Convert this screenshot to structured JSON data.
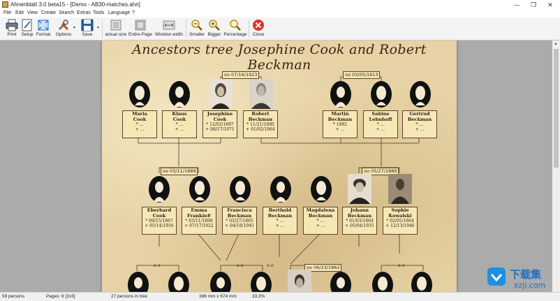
{
  "window": {
    "title": "Ahnenblatt 3.0 beta15 - [Demo - AB30-matches.ahn]",
    "min_glyph": "—",
    "max_glyph": "❐",
    "close_glyph": "✕"
  },
  "menu": [
    "File",
    "Edit",
    "View",
    "Create",
    "Search",
    "Extras",
    "Tools",
    "Language",
    "?"
  ],
  "toolbar": {
    "print": "Print",
    "setup": "Setup",
    "format": "Format",
    "options": "Options",
    "save": "Save",
    "actual_size": "actual size",
    "entire_page": "Entire Page",
    "window_width": "Window width",
    "smaller": "Smaller",
    "bigger": "Bigger",
    "percentage": "Percentage",
    "close": "Close"
  },
  "document": {
    "title": "Ancestors tree Josephine Cook and Robert Beckman",
    "marriages": {
      "top_left": "oo 07/16/1923",
      "top_right": "oo 03/05/1913",
      "mid_left": "oo 03/11/1889",
      "mid_right": "oo 05/27/1889",
      "bottom_center": "oo 06/23/1862",
      "bottom_a": "o-o",
      "bottom_b": "o-o",
      "bottom_c": "o-o",
      "bottom_d": "o-o"
    },
    "row1": [
      {
        "first": "Maria",
        "last": "Cook",
        "b": "* ...",
        "d": "+ ..."
      },
      {
        "first": "Klaus",
        "last": "Cook",
        "b": "* ...",
        "d": "+ ..."
      },
      {
        "first": "Josephine",
        "last": "Cook",
        "b": "* 12/02/1897",
        "d": "+ 06/17/1971"
      },
      {
        "first": "Robert",
        "last": "Beckman",
        "b": "* 11/21/1890",
        "d": "+ 01/02/1964"
      },
      {
        "first": "Martin",
        "last": "Beckman",
        "b": "* 1892",
        "d": "+ ..."
      },
      {
        "first": "Sabine",
        "last": "Lehnhoff",
        "b": "* ...",
        "d": "+ ..."
      },
      {
        "first": "Gertrud",
        "last": "Beckman",
        "b": "* ...",
        "d": "+ ..."
      }
    ],
    "row2": [
      {
        "first": "Eberhard",
        "last": "Cook",
        "b": "* 09/15/1867",
        "d": "+ 05/14/1916"
      },
      {
        "first": "Emma",
        "last": "Frankie#",
        "b": "* 03/11/1869",
        "d": "+ 07/17/1922"
      },
      {
        "first": "Francisca",
        "last": "Beckman",
        "b": "* 05/27/1865",
        "d": "+ 04/18/1945"
      },
      {
        "first": "Berthold",
        "last": "Beckman",
        "b": "* ...",
        "d": "+ ..."
      },
      {
        "first": "Magdalena",
        "last": "Beckman",
        "b": "* ...",
        "d": "+ ..."
      },
      {
        "first": "Johann",
        "last": "Beckman",
        "b": "* 01/03/1864",
        "d": "+ 05/04/1935"
      },
      {
        "first": "Sophie",
        "last": "Kowalski",
        "b": "* 02/05/1864",
        "d": "+ 12/13/1946"
      }
    ]
  },
  "status": {
    "persons": "59 persons",
    "pages": "Pages: 6 [2x3]",
    "in_tree": "27 persons in tree",
    "size": "388 mm x 674 mm",
    "zoom": "33,3%"
  },
  "watermark": {
    "brand": "下载集",
    "domain": "xzji.com"
  }
}
